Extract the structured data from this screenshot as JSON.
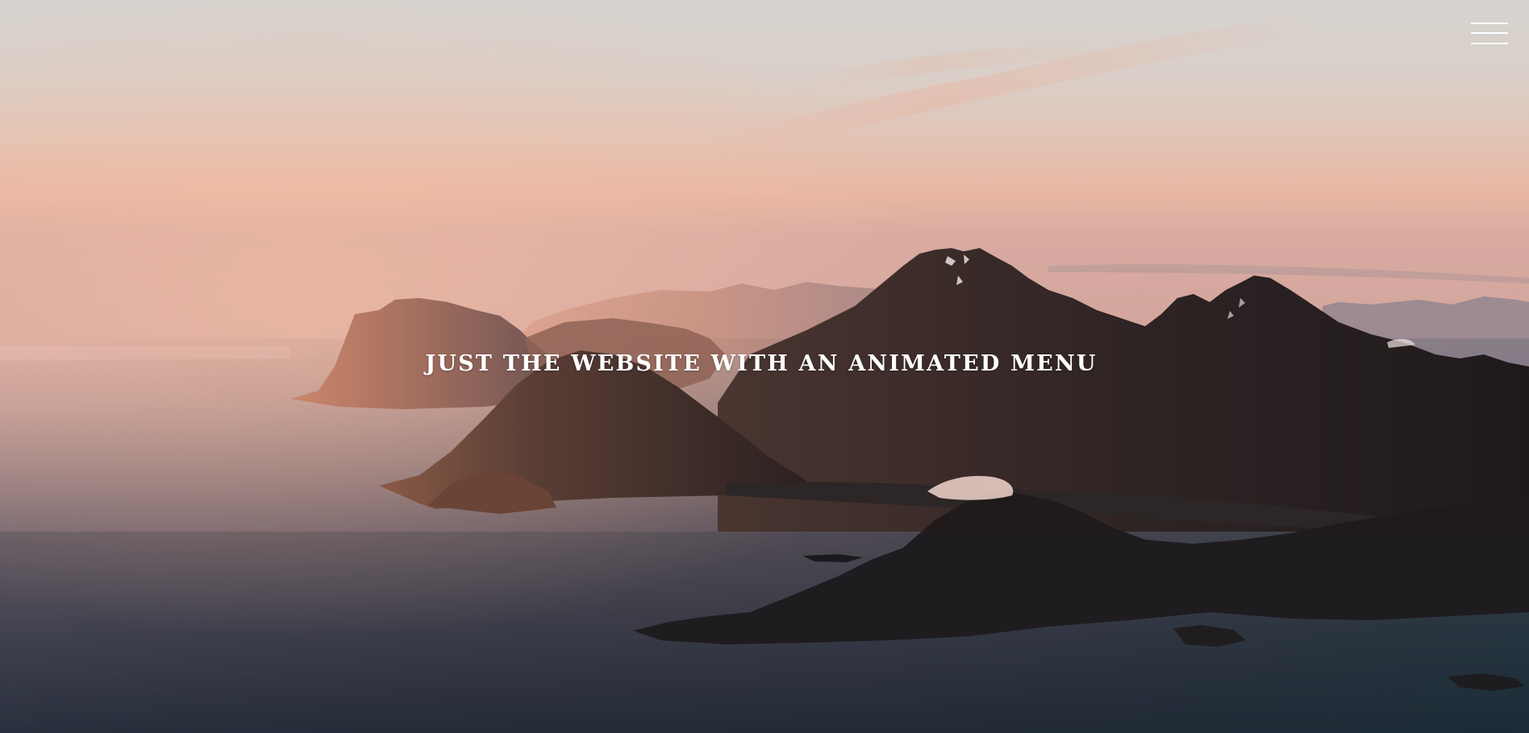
{
  "hero": {
    "headline": "JUST THE WEBSITE WITH AN ANIMATED MENU",
    "background_image": "mountain-fjord-sunset-photo"
  },
  "menu": {
    "icon": "hamburger-menu-icon"
  },
  "colors": {
    "sky_top": "#d8d3cd",
    "sky_glow": "#e6b9a6",
    "sea": "#3b3a44",
    "mountains_dark": "#231c1c",
    "text": "#ffffff"
  }
}
